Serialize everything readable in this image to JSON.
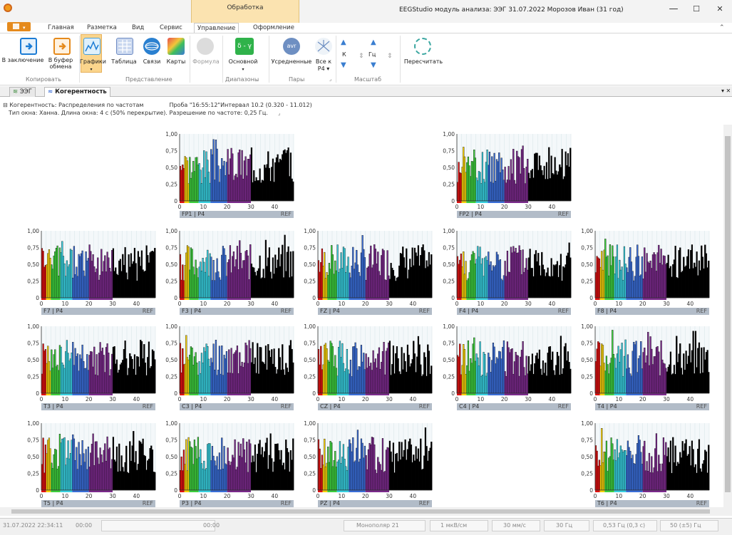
{
  "titlebar": {
    "context_tab": "Обработка",
    "title": "EEGStudio модуль анализа: ЭЭГ 31.07.2022 Морозов Иван (31 год)",
    "minimize": "—",
    "maximize": "☐",
    "close": "✕"
  },
  "ribbon_tabs": [
    "Главная",
    "Разметка",
    "Вид",
    "Сервис",
    "Управление",
    "Оформление"
  ],
  "ribbon": {
    "copy_conclusion": "В заключение",
    "copy_buffer": "В буфер обмена",
    "grp_copy": "Копировать",
    "graphs": "Графики",
    "table": "Таблица",
    "links": "Связи",
    "maps": "Карты",
    "grp_view": "Представление",
    "formula": "Формула",
    "main": "Основной",
    "grp_ranges": "Диапазоны",
    "averaged": "Усредненные",
    "all_to": "Все к",
    "all_to_sub": "P4 ▾",
    "grp_pairs": "Пары",
    "k": "К",
    "hz": "Гц",
    "grp_scale": "Масштаб",
    "recalc": "Пересчитать",
    "avr_icon_text": "avr",
    "delta_icon_text": "δ - γ"
  },
  "doc_tabs": [
    "ЭЭГ",
    "Когерентность"
  ],
  "info": {
    "line1a": "⊟ Когерентность: Распределения по частотам",
    "line1b": "Проба \"16:55:12\"Интервал 10.2 (0.320 - 11.012)",
    "line2": "Тип окна: Ханна. Длина окна: 4 с (50% перекрытие). Разрешение по частоте: 0,25 Гц."
  },
  "chart_axis": {
    "y_ticks": [
      "1,00",
      "0,75",
      "0,50",
      "0,25",
      "0"
    ],
    "x_ticks": [
      "0",
      "10",
      "20",
      "30",
      "40"
    ],
    "ref_label": "REF",
    "ylim": [
      0,
      1
    ],
    "xlim": [
      0,
      48
    ]
  },
  "charts": [
    {
      "label": "FP1 | P4"
    },
    {
      "label": "FP2 | P4"
    },
    {
      "label": "F7 | P4"
    },
    {
      "label": "F3 | P4"
    },
    {
      "label": "FZ | P4"
    },
    {
      "label": "F4 | P4"
    },
    {
      "label": "F8 | P4"
    },
    {
      "label": "T3 | P4"
    },
    {
      "label": "C3 | P4"
    },
    {
      "label": "CZ | P4"
    },
    {
      "label": "C4 | P4"
    },
    {
      "label": "T4 | P4"
    },
    {
      "label": "T5 | P4"
    },
    {
      "label": "P3 | P4"
    },
    {
      "label": "PZ | P4"
    },
    {
      "label": "T6 | P4"
    }
  ],
  "band_colors": [
    "#e01010",
    "#f6d10a",
    "#3ecf3e",
    "#38d0e0",
    "#3a6ed8",
    "#7b2a8c",
    "#000000"
  ],
  "status": {
    "datetime": "31.07.2022 22:34:11",
    "time1": "00:00",
    "time2": "00:00",
    "montage": "Монополяр 21",
    "sens": "1 мкВ/см",
    "speed": "30 мм/с",
    "lpf": "30 Гц",
    "hpf": "0,53 Гц (0,3 с)",
    "notch": "50 (±5) Гц"
  }
}
